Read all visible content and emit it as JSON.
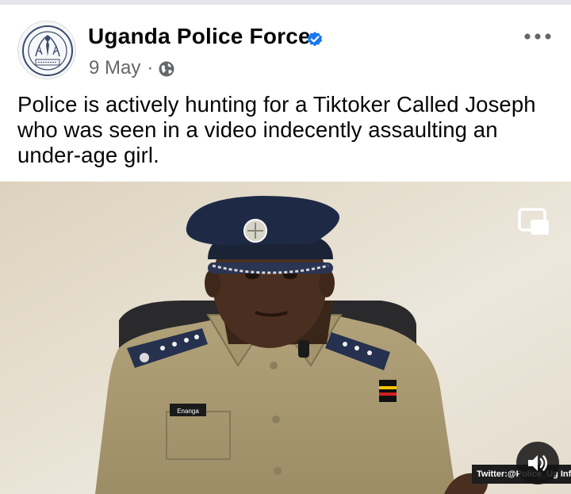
{
  "post": {
    "page_name": "Uganda Police Force",
    "date": "9 May",
    "separator": "·",
    "audience_icon": "globe-icon",
    "more_icon": "more-options-icon",
    "verified_icon": "verified-badge-icon",
    "text": "Police is actively hunting for a Tiktoker Called Joseph who was seen in a video indecently assaulting an under-age girl."
  },
  "video": {
    "watermark": "Twitter:@Police_Ug  Info:@",
    "name_tag": "Enanga",
    "pip_icon": "picture-in-picture-icon",
    "sound_icon": "speaker-icon"
  },
  "colors": {
    "verified_blue": "#1877f2",
    "secondary_text": "#65676b",
    "uniform_khaki": "#a99a72",
    "cap_navy": "#1e2a45"
  }
}
